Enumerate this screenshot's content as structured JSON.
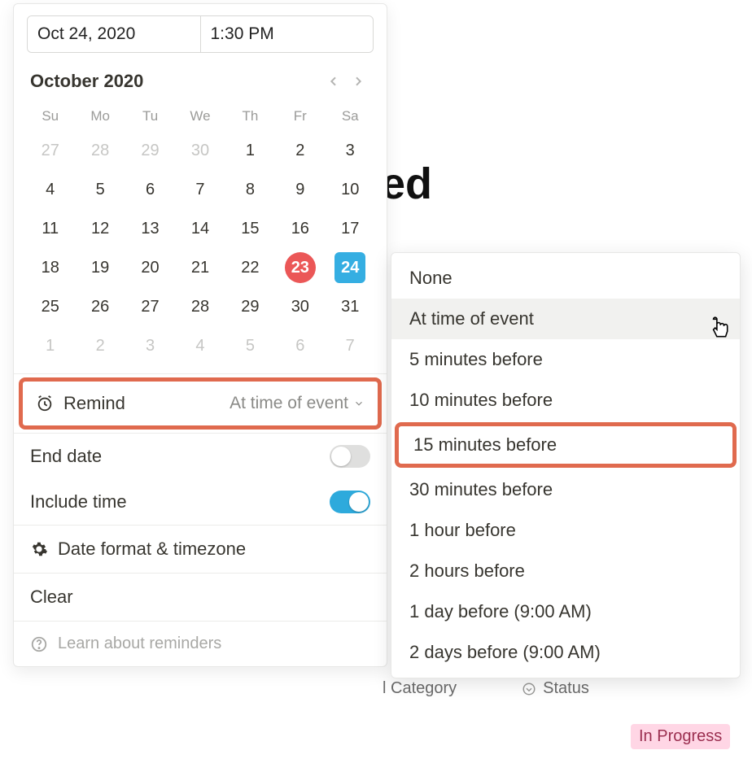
{
  "background": {
    "title_fragment": "ted",
    "columns": {
      "category": "l Category",
      "status": "Status"
    },
    "status_badge": "In Progress"
  },
  "datepicker": {
    "date_value": "Oct 24, 2020",
    "time_value": "1:30 PM",
    "month_label": "October 2020",
    "weekdays": [
      "Su",
      "Mo",
      "Tu",
      "We",
      "Th",
      "Fr",
      "Sa"
    ],
    "grid": [
      [
        {
          "n": "27",
          "dim": true
        },
        {
          "n": "28",
          "dim": true
        },
        {
          "n": "29",
          "dim": true
        },
        {
          "n": "30",
          "dim": true
        },
        {
          "n": "1"
        },
        {
          "n": "2"
        },
        {
          "n": "3"
        }
      ],
      [
        {
          "n": "4"
        },
        {
          "n": "5"
        },
        {
          "n": "6"
        },
        {
          "n": "7"
        },
        {
          "n": "8"
        },
        {
          "n": "9"
        },
        {
          "n": "10"
        }
      ],
      [
        {
          "n": "11"
        },
        {
          "n": "12"
        },
        {
          "n": "13"
        },
        {
          "n": "14"
        },
        {
          "n": "15"
        },
        {
          "n": "16"
        },
        {
          "n": "17"
        }
      ],
      [
        {
          "n": "18"
        },
        {
          "n": "19"
        },
        {
          "n": "20"
        },
        {
          "n": "21"
        },
        {
          "n": "22"
        },
        {
          "n": "23",
          "today": true
        },
        {
          "n": "24",
          "selected": true
        }
      ],
      [
        {
          "n": "25"
        },
        {
          "n": "26"
        },
        {
          "n": "27"
        },
        {
          "n": "28"
        },
        {
          "n": "29"
        },
        {
          "n": "30"
        },
        {
          "n": "31"
        }
      ],
      [
        {
          "n": "1",
          "dim": true
        },
        {
          "n": "2",
          "dim": true
        },
        {
          "n": "3",
          "dim": true
        },
        {
          "n": "4",
          "dim": true
        },
        {
          "n": "5",
          "dim": true
        },
        {
          "n": "6",
          "dim": true
        },
        {
          "n": "7",
          "dim": true
        }
      ]
    ],
    "remind": {
      "label": "Remind",
      "value": "At time of event"
    },
    "end_date_label": "End date",
    "end_date_on": false,
    "include_time_label": "Include time",
    "include_time_on": true,
    "format_label": "Date format & timezone",
    "clear_label": "Clear",
    "help_label": "Learn about reminders"
  },
  "reminder_menu": {
    "items": [
      {
        "label": "None"
      },
      {
        "label": "At time of event",
        "hover": true
      },
      {
        "label": "5 minutes before"
      },
      {
        "label": "10 minutes before"
      },
      {
        "label": "15 minutes before",
        "boxed": true
      },
      {
        "label": "30 minutes before"
      },
      {
        "label": "1 hour before"
      },
      {
        "label": "2 hours before"
      },
      {
        "label": "1 day before (9:00 AM)"
      },
      {
        "label": "2 days before (9:00 AM)"
      }
    ]
  }
}
